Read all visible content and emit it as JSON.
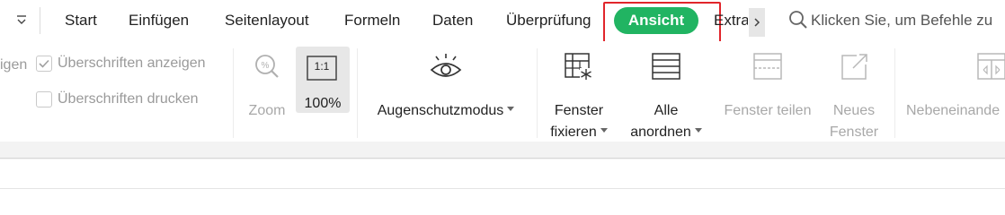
{
  "tabs": {
    "items": [
      "Start",
      "Einfügen",
      "Seitenlayout",
      "Formeln",
      "Daten",
      "Überprüfung"
    ],
    "active": "Ansicht",
    "extras": "Extras"
  },
  "search": {
    "placeholder": "Klicken Sie, um Befehle zu"
  },
  "ribbon": {
    "cut_label": "igen",
    "show_headings": "Überschriften anzeigen",
    "print_headings": "Überschriften drucken",
    "zoom": "Zoom",
    "zoom_100": "100%",
    "zoom_100_icon_text": "1:1",
    "eye_protection": "Augenschutzmodus",
    "freeze_line1": "Fenster",
    "freeze_line2": "fixieren",
    "arrange_line1": "Alle",
    "arrange_line2": "anordnen",
    "split": "Fenster teilen",
    "new_line1": "Neues",
    "new_line2": "Fenster",
    "side_by_side": "Nebeneinande"
  },
  "state": {
    "show_headings_checked": true,
    "print_headings_checked": false
  },
  "colors": {
    "active_tab": "#21b462",
    "highlight_box": "#e1252b"
  }
}
